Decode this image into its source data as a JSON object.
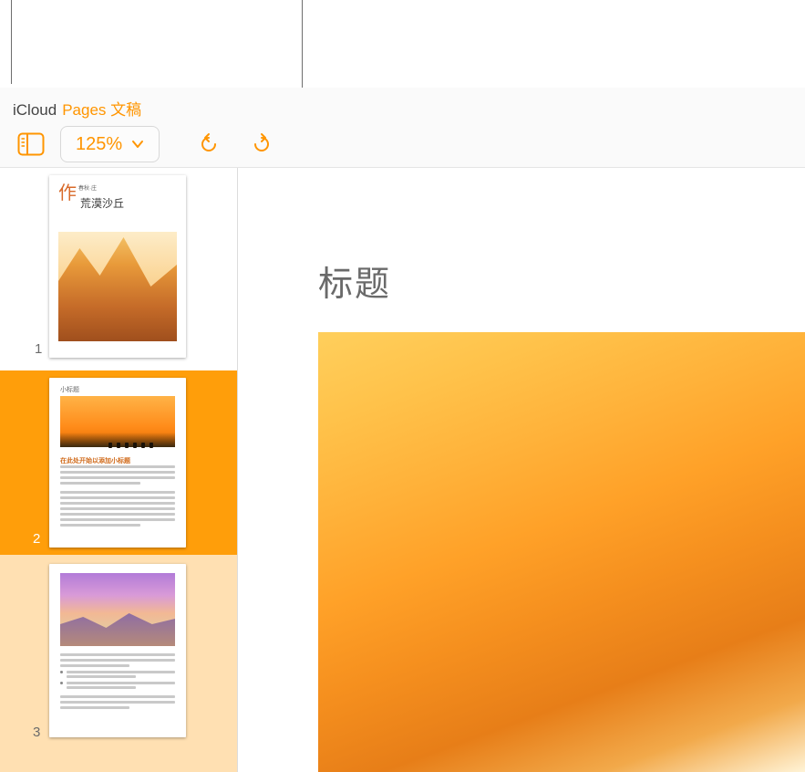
{
  "breadcrumb": {
    "primary": "iCloud",
    "accent": "Pages 文稿"
  },
  "toolbar": {
    "view_icon": "sidebar-panel-icon",
    "zoom_value": "125%",
    "undo_icon": "undo-icon",
    "redo_icon": "redo-icon"
  },
  "sidebar": {
    "thumbnails": [
      {
        "number": "1",
        "selected": false,
        "title_char": "作",
        "mini_label": "春秋·庄",
        "title_text": "荒漠沙丘"
      },
      {
        "number": "2",
        "selected": true,
        "small_heading": "小标题",
        "section_heading": "在此处开始以添加小标题"
      },
      {
        "number": "3",
        "selected": true
      }
    ]
  },
  "canvas": {
    "page_title": "标题"
  },
  "colors": {
    "accent": "#ff9500",
    "selection": "#ff9e0a",
    "selection_secondary": "#ffe0b2"
  }
}
